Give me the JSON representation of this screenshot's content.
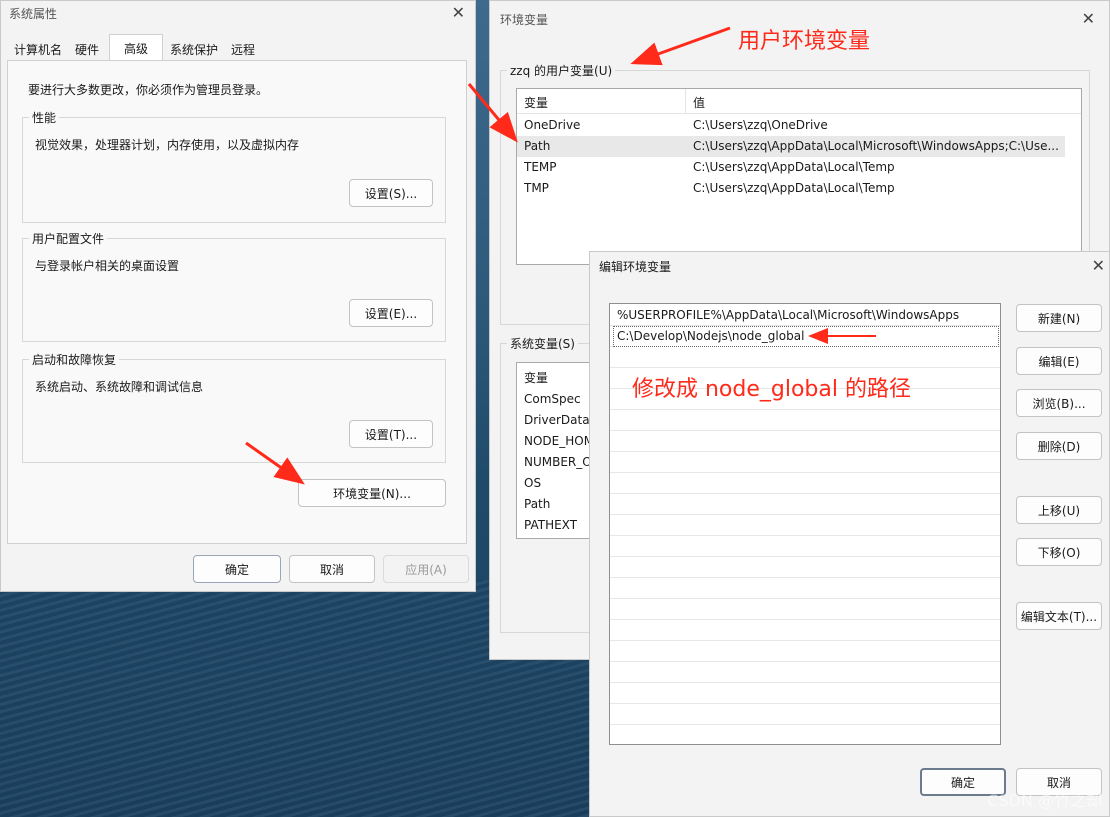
{
  "sys_props": {
    "title": "系统属性",
    "tabs": [
      "计算机名",
      "硬件",
      "高级",
      "系统保护",
      "远程"
    ],
    "active_tab": "高级",
    "admin_notice": "要进行大多数更改，你必须作为管理员登录。",
    "performance": {
      "title": "性能",
      "desc": "视觉效果，处理器计划，内存使用，以及虚拟内存",
      "button": "设置(S)..."
    },
    "profile": {
      "title": "用户配置文件",
      "desc": "与登录帐户相关的桌面设置",
      "button": "设置(E)..."
    },
    "startup": {
      "title": "启动和故障恢复",
      "desc": "系统启动、系统故障和调试信息",
      "button": "设置(T)..."
    },
    "env_button": "环境变量(N)...",
    "ok": "确定",
    "cancel": "取消",
    "apply": "应用(A)"
  },
  "env_vars": {
    "title": "环境变量",
    "user_group": "zzq 的用户变量(U)",
    "col_var": "变量",
    "col_val": "值",
    "user_rows": [
      {
        "name": "OneDrive",
        "value": "C:\\Users\\zzq\\OneDrive"
      },
      {
        "name": "Path",
        "value": "C:\\Users\\zzq\\AppData\\Local\\Microsoft\\WindowsApps;C:\\Use..."
      },
      {
        "name": "TEMP",
        "value": "C:\\Users\\zzq\\AppData\\Local\\Temp"
      },
      {
        "name": "TMP",
        "value": "C:\\Users\\zzq\\AppData\\Local\\Temp"
      }
    ],
    "sys_group": "系统变量(S)",
    "sys_rows": [
      "ComSpec",
      "DriverData",
      "NODE_HOME",
      "NUMBER_OF_PROCESSORS",
      "OS",
      "Path",
      "PATHEXT"
    ]
  },
  "edit_env": {
    "title": "编辑环境变量",
    "entries": [
      "%USERPROFILE%\\AppData\\Local\\Microsoft\\WindowsApps",
      "C:\\Develop\\Nodejs\\node_global"
    ],
    "buttons": {
      "new": "新建(N)",
      "edit": "编辑(E)",
      "browse": "浏览(B)...",
      "delete": "删除(D)",
      "up": "上移(U)",
      "down": "下移(O)",
      "edit_text": "编辑文本(T)..."
    },
    "ok": "确定",
    "cancel": "取消"
  },
  "annotations": {
    "user_env": "用户环境变量",
    "modify_path": "修改成 node_global 的路径"
  },
  "watermark": "CSDN @竹之却",
  "colors": {
    "annotation": "#ff2a1a",
    "selected_row": "#e8e8e8"
  }
}
